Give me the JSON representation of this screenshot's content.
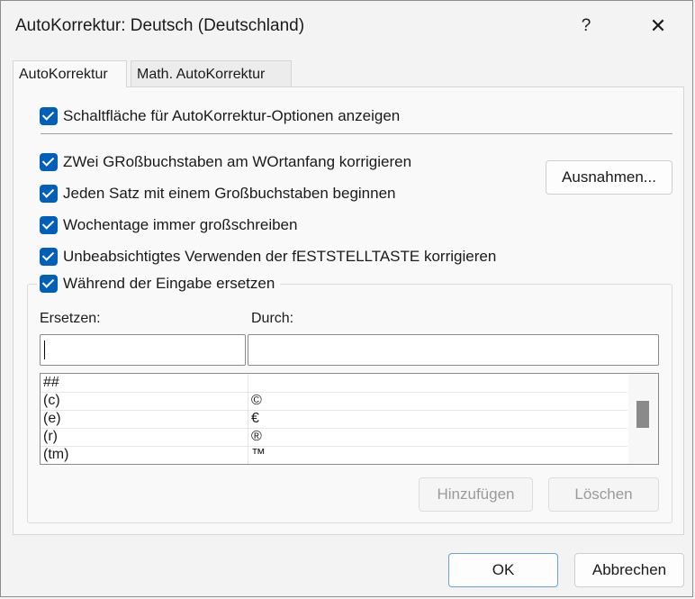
{
  "window": {
    "title": "AutoKorrektur: Deutsch (Deutschland)",
    "help_label": "?",
    "close_label": "✕"
  },
  "tabs": [
    {
      "label": "AutoKorrektur",
      "active": true
    },
    {
      "label": "Math. AutoKorrektur",
      "active": false
    }
  ],
  "options": {
    "show_buttons": {
      "label": "Schaltfläche für AutoKorrektur-Optionen anzeigen",
      "checked": true
    },
    "two_caps": {
      "label": "ZWei GRoßbuchstaben am WOrtanfang korrigieren",
      "checked": true
    },
    "sentence_cap": {
      "label": "Jeden Satz mit einem Großbuchstaben beginnen",
      "checked": true
    },
    "weekdays": {
      "label": "Wochentage immer großschreiben",
      "checked": true
    },
    "capslock": {
      "label": "Unbeabsichtigtes Verwenden der fESTSTELLTASTE korrigieren",
      "checked": true
    },
    "replace_typing": {
      "label": "Während der Eingabe ersetzen",
      "checked": true
    }
  },
  "exceptions_button": "Ausnahmen...",
  "replace": {
    "replace_label": "Ersetzen:",
    "with_label": "Durch:",
    "replace_value": "",
    "with_value": "",
    "entries": [
      {
        "from": "##",
        "to": ""
      },
      {
        "from": "(c)",
        "to": "©"
      },
      {
        "from": "(e)",
        "to": "€"
      },
      {
        "from": "(r)",
        "to": "®"
      },
      {
        "from": "(tm)",
        "to": "™"
      }
    ],
    "add_button": "Hinzufügen",
    "delete_button": "Löschen"
  },
  "footer": {
    "ok_button": "OK",
    "cancel_button": "Abbrechen"
  },
  "colors": {
    "accent": "#005fb8",
    "background": "#f3f3f3"
  }
}
